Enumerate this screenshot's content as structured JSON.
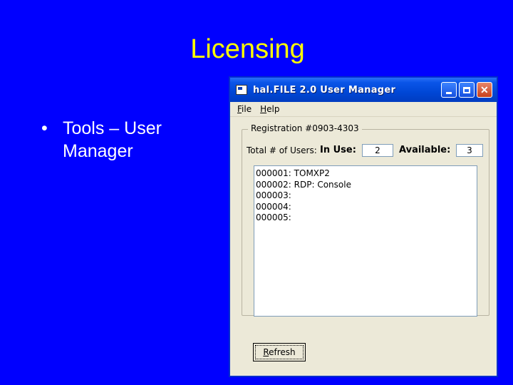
{
  "slide": {
    "title": "Licensing",
    "bullets": [
      {
        "dot": "•",
        "text": "Tools – User Manager"
      }
    ]
  },
  "window": {
    "title": "hal.FILE 2.0 User Manager",
    "menu": [
      {
        "mnemonic": "F",
        "rest": "ile"
      },
      {
        "mnemonic": "H",
        "rest": "elp"
      }
    ],
    "registration_label": "Registration #0903-4303",
    "total_users_label": "Total # of Users:",
    "in_use_label": "In Use:",
    "in_use_value": "2",
    "available_label": "Available:",
    "available_value": "3",
    "users": [
      "000001: TOMXP2",
      "000002: RDP: Console",
      "000003:",
      "000004:",
      "000005:"
    ],
    "refresh_button": {
      "mnemonic": "R",
      "rest": "efresh"
    }
  }
}
